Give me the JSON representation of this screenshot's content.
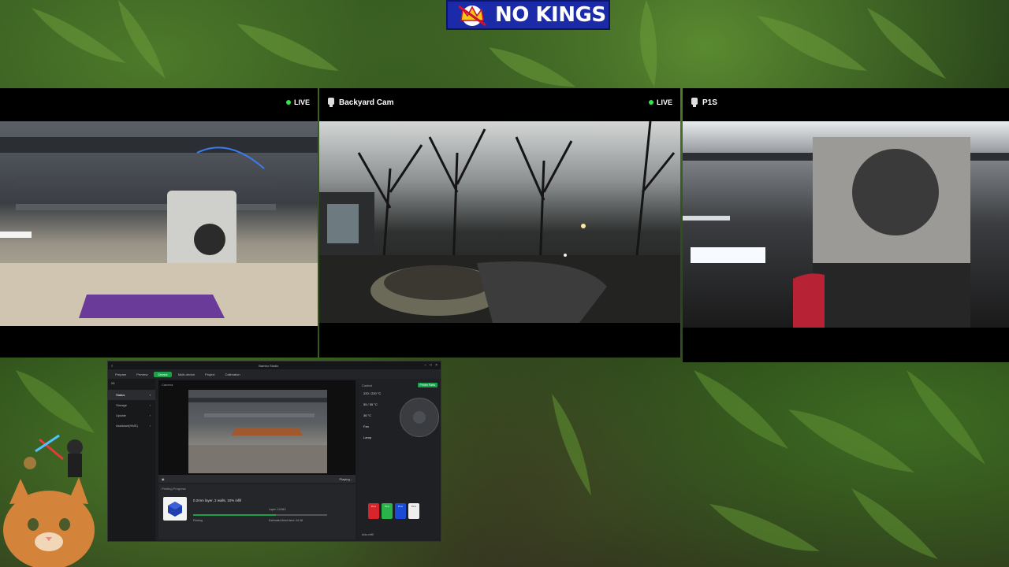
{
  "banner": {
    "text": "NO KINGS"
  },
  "cameras": [
    {
      "name": "",
      "status": "LIVE"
    },
    {
      "name": "Backyard Cam",
      "status": "LIVE"
    },
    {
      "name": "P1S",
      "status": ""
    }
  ],
  "studio": {
    "app_title": "Bambu Studio",
    "device": "X1",
    "tabs": [
      "Prepare",
      "Preview",
      "Device",
      "Multi-device",
      "Project",
      "Calibration"
    ],
    "active_tab": "Device",
    "sidebar": [
      "Status",
      "Storage",
      "Update",
      "Assistant(HMS)"
    ],
    "camera_label": "Camera",
    "playing": "Playing...",
    "progress_header": "Printing Progress",
    "job": "0.2mm layer, 2 walls, 10% infill",
    "progress": 0.62,
    "layer": "Layer: 10/343",
    "eta": "Estimated finish time: 04:18",
    "state": "Printing",
    "control_label": "Control",
    "printer_parts": "Printer Parts",
    "temps": [
      "220 / 220 °C",
      "55 / 55 °C",
      "36 °C"
    ],
    "fan": "Fan",
    "lamp": "Lamp",
    "ams": [
      {
        "label": "PLA",
        "color": "#d8242b"
      },
      {
        "label": "PLA",
        "color": "#29b34a"
      },
      {
        "label": "PLA",
        "color": "#1a4bd6"
      },
      {
        "label": "PLA",
        "color": "#eeeeee"
      }
    ],
    "auto_refill": "Auto-refill"
  },
  "colors": {
    "live_dot": "#2ee84b",
    "accent": "#1aa24b",
    "banner": "#1a2aa8"
  }
}
